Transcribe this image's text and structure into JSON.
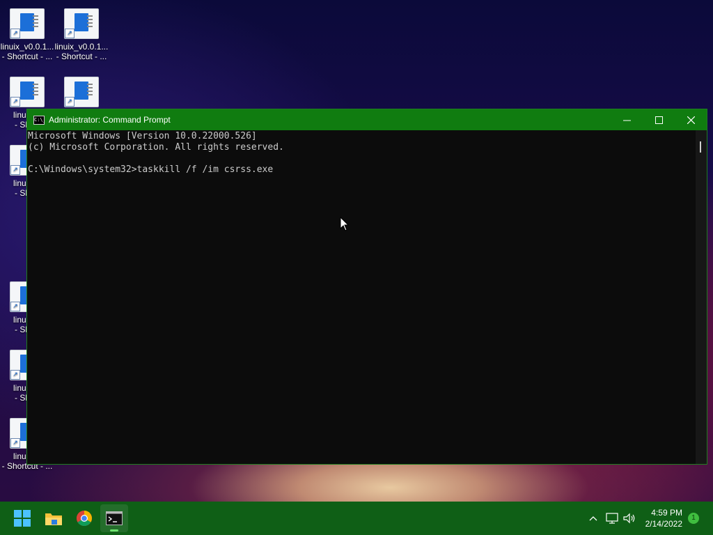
{
  "desktop": {
    "icons": [
      {
        "label1": "linuix_v0.0.1...",
        "label2": "- Shortcut - ..."
      },
      {
        "label1": "linuix_v0.0.1...",
        "label2": "- Shortcut - ..."
      },
      {
        "label1": "linuix_v",
        "label2": "- Short"
      },
      {
        "label1": "",
        "label2": ""
      },
      {
        "label1": "linuix_v",
        "label2": "- Short"
      },
      {
        "label1": "linuix_v",
        "label2": "- Short"
      },
      {
        "label1": "linuix_v",
        "label2": "- Short"
      },
      {
        "label1": "linuix_v",
        "label2": "- Shortcut - ..."
      }
    ]
  },
  "window": {
    "title": "Administrator: Command Prompt",
    "icon_text": "C:\\_",
    "minimize": "—",
    "maximize": "☐",
    "close": "✕",
    "console_lines": [
      "Microsoft Windows [Version 10.0.22000.526]",
      "(c) Microsoft Corporation. All rights reserved.",
      "",
      "C:\\Windows\\system32>taskkill /f /im csrss.exe"
    ]
  },
  "taskbar": {
    "time": "4:59 PM",
    "date": "2/14/2022",
    "notification_count": "1",
    "tray_chevron": "^"
  },
  "colors": {
    "titlebar": "#107c10",
    "taskbar": "#0f5f16",
    "console_bg": "#0c0c0c",
    "console_text": "#cccccc"
  }
}
